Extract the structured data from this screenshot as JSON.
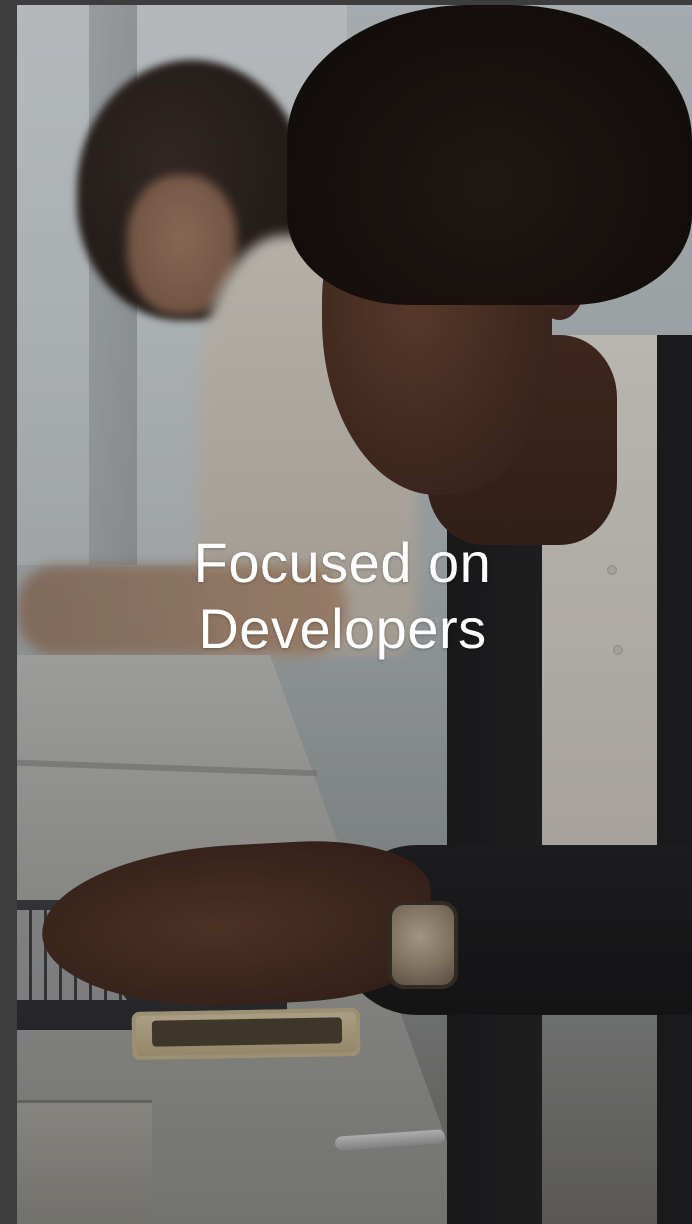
{
  "hero": {
    "title_line_1": "Focused on",
    "title_line_2": "Developers",
    "text_color": "#ffffff"
  },
  "frame": {
    "background_color": "#3a3a3a"
  },
  "photo": {
    "subject": "developer-typing-on-laptop"
  }
}
